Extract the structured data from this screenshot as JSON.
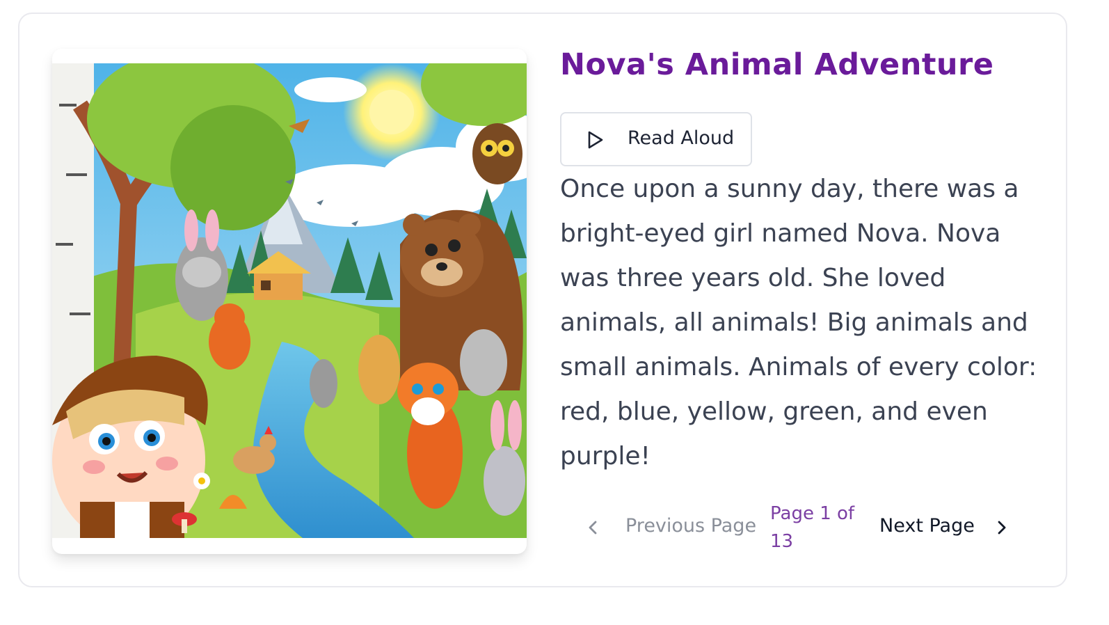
{
  "story": {
    "title": "Nova's Animal Adventure",
    "read_aloud_label": "Read Aloud",
    "text": "Once upon a sunny day, there was a bright-eyed girl named Nova. Nova was three years old. She loved animals, all animals! Big animals and small animals. Animals of every color: red, blue, yellow, green, and even purple!"
  },
  "pagination": {
    "previous_label": "Previous Page",
    "page_indicator": "Page 1 of 13",
    "next_label": "Next Page",
    "current_page": 1,
    "total_pages": 13
  },
  "icons": {
    "read_aloud": "play-icon",
    "previous": "chevron-left-icon",
    "next": "chevron-right-icon"
  },
  "colors": {
    "title": "#6a1b9a",
    "page_indicator": "#7b3fa3",
    "body_text": "#3b4252",
    "disabled_text": "#8a8f99"
  }
}
